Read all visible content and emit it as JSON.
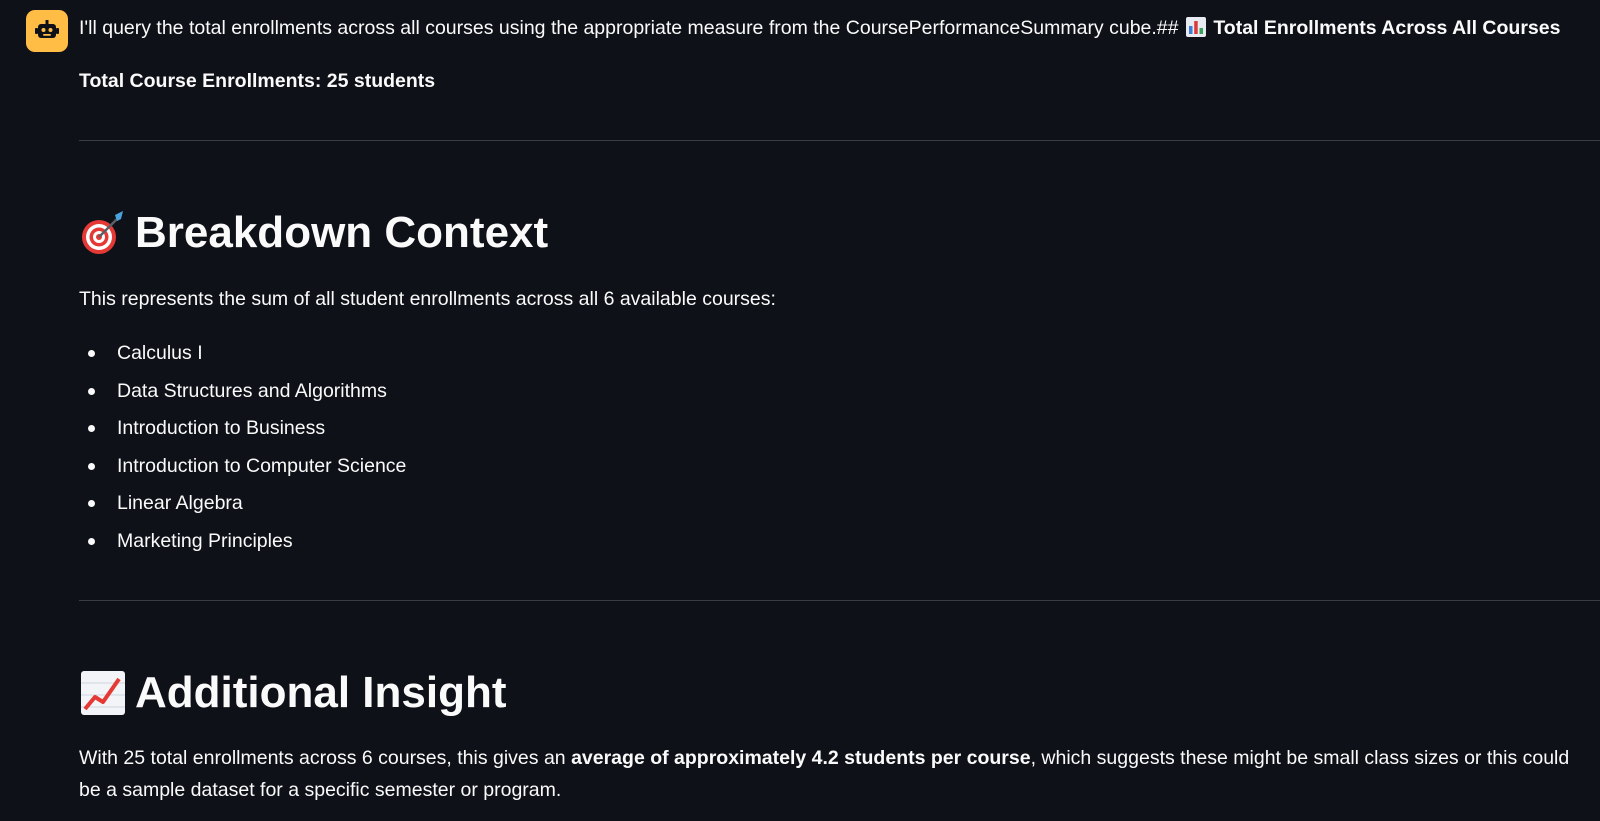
{
  "message": {
    "avatar_icon": "robot-icon",
    "avatar_color": "#ffbd45",
    "intro_text": "I'll query the total enrollments across all courses using the appropriate measure from the CoursePerformanceSummary cube.##",
    "intro_icon": "bar-chart-icon",
    "intro_heading": "Total Enrollments Across All Courses",
    "summary": "Total Course Enrollments: 25 students",
    "breakdown": {
      "icon": "target-dart-icon",
      "title": "Breakdown Context",
      "description": "This represents the sum of all student enrollments across all 6 available courses:",
      "courses": [
        "Calculus I",
        "Data Structures and Algorithms",
        "Introduction to Business",
        "Introduction to Computer Science",
        "Linear Algebra",
        "Marketing Principles"
      ]
    },
    "insight": {
      "icon": "chart-increasing-icon",
      "title": "Additional Insight",
      "text_before": "With 25 total enrollments across 6 courses, this gives an ",
      "text_bold": "average of approximately 4.2 students per course",
      "text_after": ", which suggests these might be small class sizes or this could be a sample dataset for a specific semester or program."
    }
  },
  "colors": {
    "background": "#0e1117",
    "text": "#fafafa",
    "divider": "#3a3d45"
  }
}
